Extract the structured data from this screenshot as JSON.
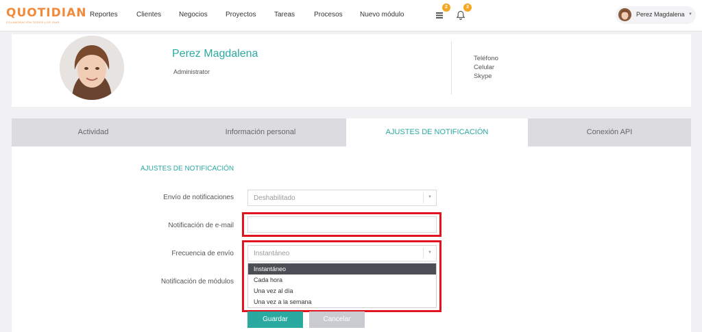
{
  "logo": {
    "word": "QUOTIDIAN",
    "tagline": "COLABORACIÓN TODOS LOS DÍAS"
  },
  "nav": {
    "items": [
      "Reportes",
      "Clientes",
      "Negocios",
      "Proyectos",
      "Tareas",
      "Procesos",
      "Nuevo módulo"
    ],
    "icons": [
      {
        "name": "list-icon",
        "badge": "2"
      },
      {
        "name": "bell-icon",
        "badge": "3"
      }
    ],
    "user_name": "Perez Magdalena"
  },
  "profile": {
    "name": "Perez Magdalena",
    "role": "Administrator",
    "contact": [
      "Teléfono",
      "Celular",
      "Skype"
    ]
  },
  "tabs": [
    "Actividad",
    "Información personal",
    "AJUSTES DE NOTIFICACIÓN",
    "Conexión API"
  ],
  "active_tab": 2,
  "form": {
    "title": "AJUSTES DE NOTIFICACIÓN",
    "fields": {
      "envio": {
        "label": "Envío de notificaciones",
        "value": "Deshabilitado"
      },
      "email": {
        "label": "Notificación de e-mail",
        "value": ""
      },
      "frecuencia": {
        "label": "Frecuencia de envío",
        "value": "Instantáneo"
      },
      "modulos": {
        "label": "Notificación de módulos"
      }
    },
    "frequency_options": [
      "Instantáneo",
      "Cada hora",
      "Una vez al día",
      "Una vez a la semana"
    ],
    "selected_option": "Instantáneo",
    "save_label": "Guardar",
    "cancel_label": "Cancelar"
  },
  "colors": {
    "accent": "#2aa9a1",
    "brand": "#f28a3c",
    "badge": "#f5a623",
    "highlight": "#e0141e"
  }
}
